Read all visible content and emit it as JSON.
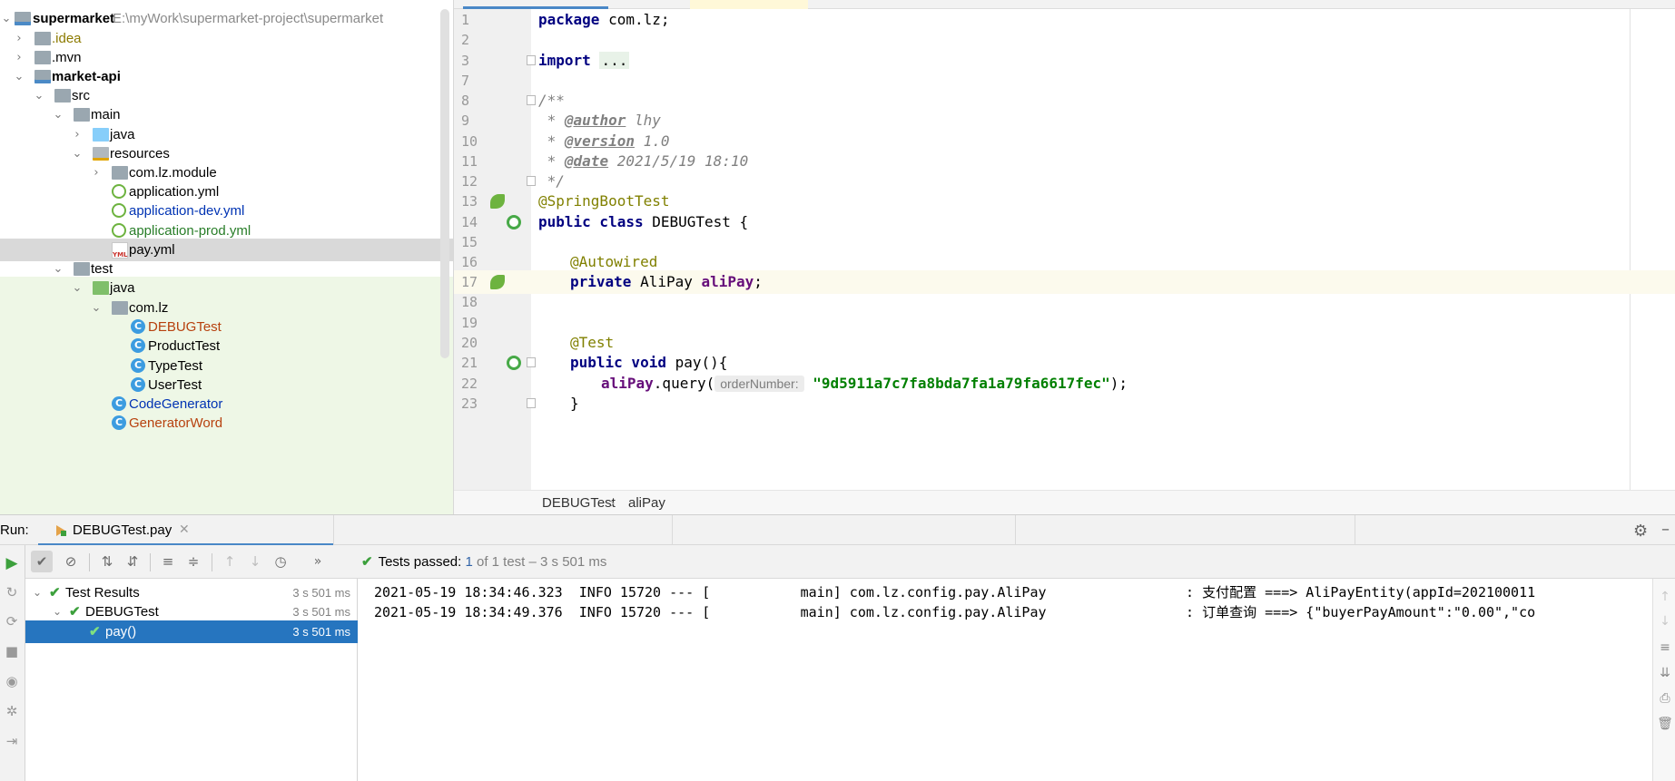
{
  "project": {
    "root_name": "supermarket",
    "root_path": "E:\\myWork\\supermarket-project\\supermarket",
    "items": [
      {
        "label": "supermarket",
        "hint": "E:\\myWork\\supermarket-project\\supermarket"
      },
      {
        "label": ".idea"
      },
      {
        "label": ".mvn"
      },
      {
        "label": "market-api"
      },
      {
        "label": "src"
      },
      {
        "label": "main"
      },
      {
        "label": "java"
      },
      {
        "label": "resources"
      },
      {
        "label": "com.lz.module"
      },
      {
        "label": "application.yml"
      },
      {
        "label": "application-dev.yml"
      },
      {
        "label": "application-prod.yml"
      },
      {
        "label": "pay.yml"
      },
      {
        "label": "test"
      },
      {
        "label": "java"
      },
      {
        "label": "com.lz"
      },
      {
        "label": "DEBUGTest"
      },
      {
        "label": "ProductTest"
      },
      {
        "label": "TypeTest"
      },
      {
        "label": "UserTest"
      },
      {
        "label": "CodeGenerator"
      },
      {
        "label": "GeneratorWord"
      }
    ],
    "colors": {
      "modified_file": "#0033b3",
      "new_file": "#287d28",
      "debug_file": "#b7410e",
      "selection": "#d9d9d9",
      "test_bg": "#eef7e6"
    }
  },
  "editor": {
    "lines": [
      {
        "n": "1"
      },
      {
        "n": "2"
      },
      {
        "n": "3"
      },
      {
        "n": "7"
      },
      {
        "n": "8"
      },
      {
        "n": "9"
      },
      {
        "n": "10"
      },
      {
        "n": "11"
      },
      {
        "n": "12"
      },
      {
        "n": "13"
      },
      {
        "n": "14"
      },
      {
        "n": "15"
      },
      {
        "n": "16"
      },
      {
        "n": "17"
      },
      {
        "n": "18"
      },
      {
        "n": "19"
      },
      {
        "n": "20"
      },
      {
        "n": "21"
      },
      {
        "n": "22"
      },
      {
        "n": "23"
      }
    ],
    "code": {
      "package_kw": "package",
      "package_name": " com.lz;",
      "import_kw": "import",
      "import_fold": "...",
      "doc_open": "/**",
      "author_tag": "@author",
      "author_val": " lhy",
      "version_tag": "@version",
      "version_val": " 1.0",
      "date_tag": "@date",
      "date_val": " 2021/5/19 18:10",
      "doc_close": " */",
      "ann_springboot": "@SpringBootTest",
      "public_class_kw": "public class",
      "class_name": " DEBUGTest {",
      "ann_autowired": "@Autowired",
      "private_kw": "private",
      "field_type": " AliPay ",
      "field_name": "aliPay",
      "field_semicolon": ";",
      "ann_test": "@Test",
      "public_void_kw": "public void",
      "method_sig": " pay(){",
      "call_obj": "aliPay",
      "call_method": ".query(",
      "param_hint": "orderNumber:",
      "call_arg": "\"9d5911a7c7fa8bda7fa1a79fa6617fec\"",
      "call_end": ");",
      "close_brace": "}",
      "doc_star": " * "
    },
    "breadcrumb": [
      "DEBUGTest",
      "›",
      "aliPay"
    ]
  },
  "run": {
    "label": "Run:",
    "tab_label": "DEBUGTest.pay",
    "tab_close": "✕",
    "status_prefix": "Tests passed:",
    "status_count": "1",
    "status_detail": "of 1 test – 3 s 501 ms",
    "collapse_glyph": "»",
    "tree": [
      {
        "name": "Test Results",
        "time": "3 s 501 ms"
      },
      {
        "name": "DEBUGTest",
        "time": "3 s 501 ms"
      },
      {
        "name": "pay()",
        "time": "3 s 501 ms"
      }
    ],
    "console": [
      "2021-05-19 18:34:46.323  INFO 15720 --- [           main] com.lz.config.pay.AliPay                 : 支付配置 ===> AliPayEntity(appId=202100011",
      "2021-05-19 18:34:49.376  INFO 15720 --- [           main] com.lz.config.pay.AliPay                 : 订单查询 ===> {\"buyerPayAmount\":\"0.00\",\"co"
    ],
    "accent": "#2675bf",
    "pass_color": "#3ca03c"
  }
}
